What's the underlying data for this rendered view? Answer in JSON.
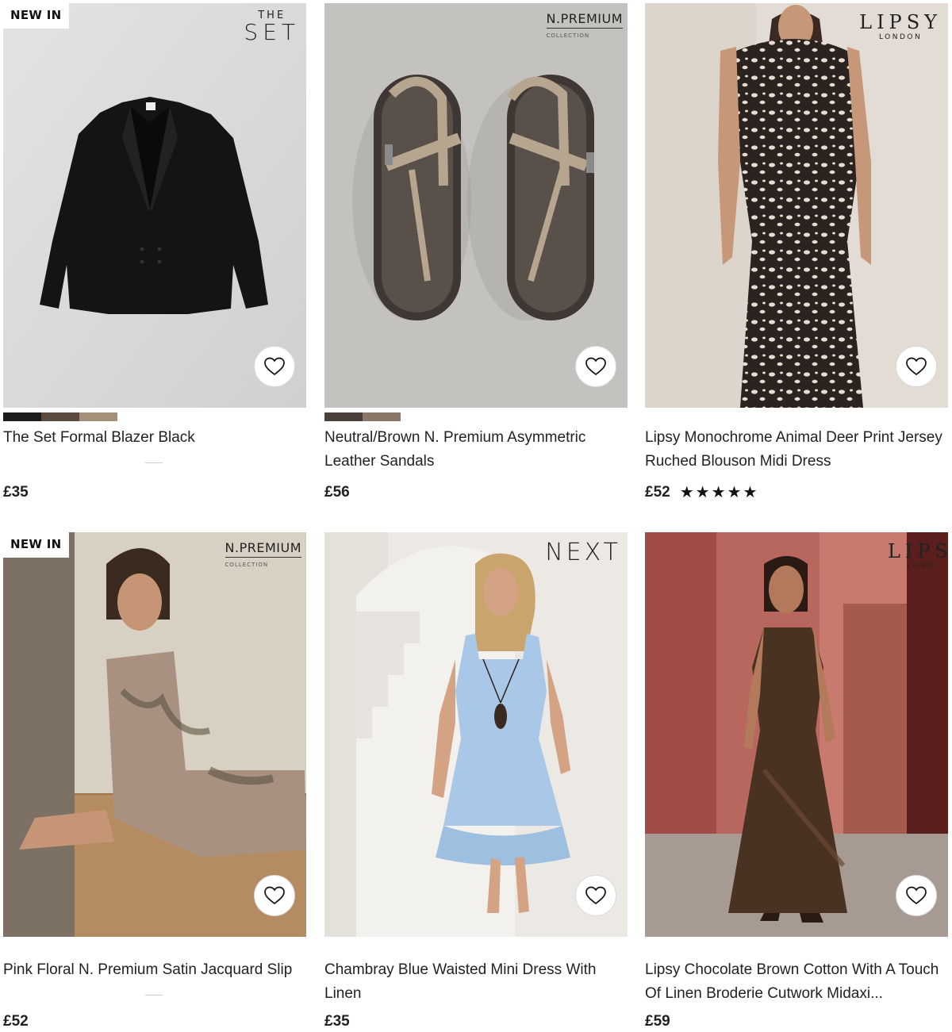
{
  "products": [
    {
      "badge": "NEW IN",
      "brand_line1": "THE",
      "brand_line2": "SET",
      "title": "The Set Formal Blazer Black",
      "price": "£35",
      "swatches": [
        "#1c1c1c",
        "#5b4a3e",
        "#a58f7a"
      ]
    },
    {
      "brand_line1": "N.PREMIUM",
      "brand_line2": "COLLECTION",
      "title": "Neutral/Brown N. Premium Asymmetric Leather Sandals",
      "price": "£56",
      "swatches": [
        "#4a3f39",
        "#8b7768"
      ]
    },
    {
      "brand_line1": "LIPSY",
      "brand_line2": "LONDON",
      "title": "Lipsy Monochrome Animal Deer Print Jersey Ruched Blouson Midi Dress",
      "price": "£52",
      "rating": 5
    },
    {
      "badge": "NEW IN",
      "brand_line1": "N.PREMIUM",
      "brand_line2": "COLLECTION",
      "title": "Pink Floral N. Premium Satin Jacquard Slip",
      "price": "£52"
    },
    {
      "brand_line1": "NEXT",
      "title": "Chambray Blue Waisted Mini Dress With Linen",
      "price": "£35"
    },
    {
      "brand_line1": "LIPS",
      "brand_line2": "LOND",
      "title": "Lipsy Chocolate Brown Cotton With A Touch Of Linen Broderie Cutwork Midaxi...",
      "price": "£59"
    }
  ],
  "icons": {
    "favourite": "heart-outline-icon",
    "rating_star": "star-filled-icon"
  }
}
